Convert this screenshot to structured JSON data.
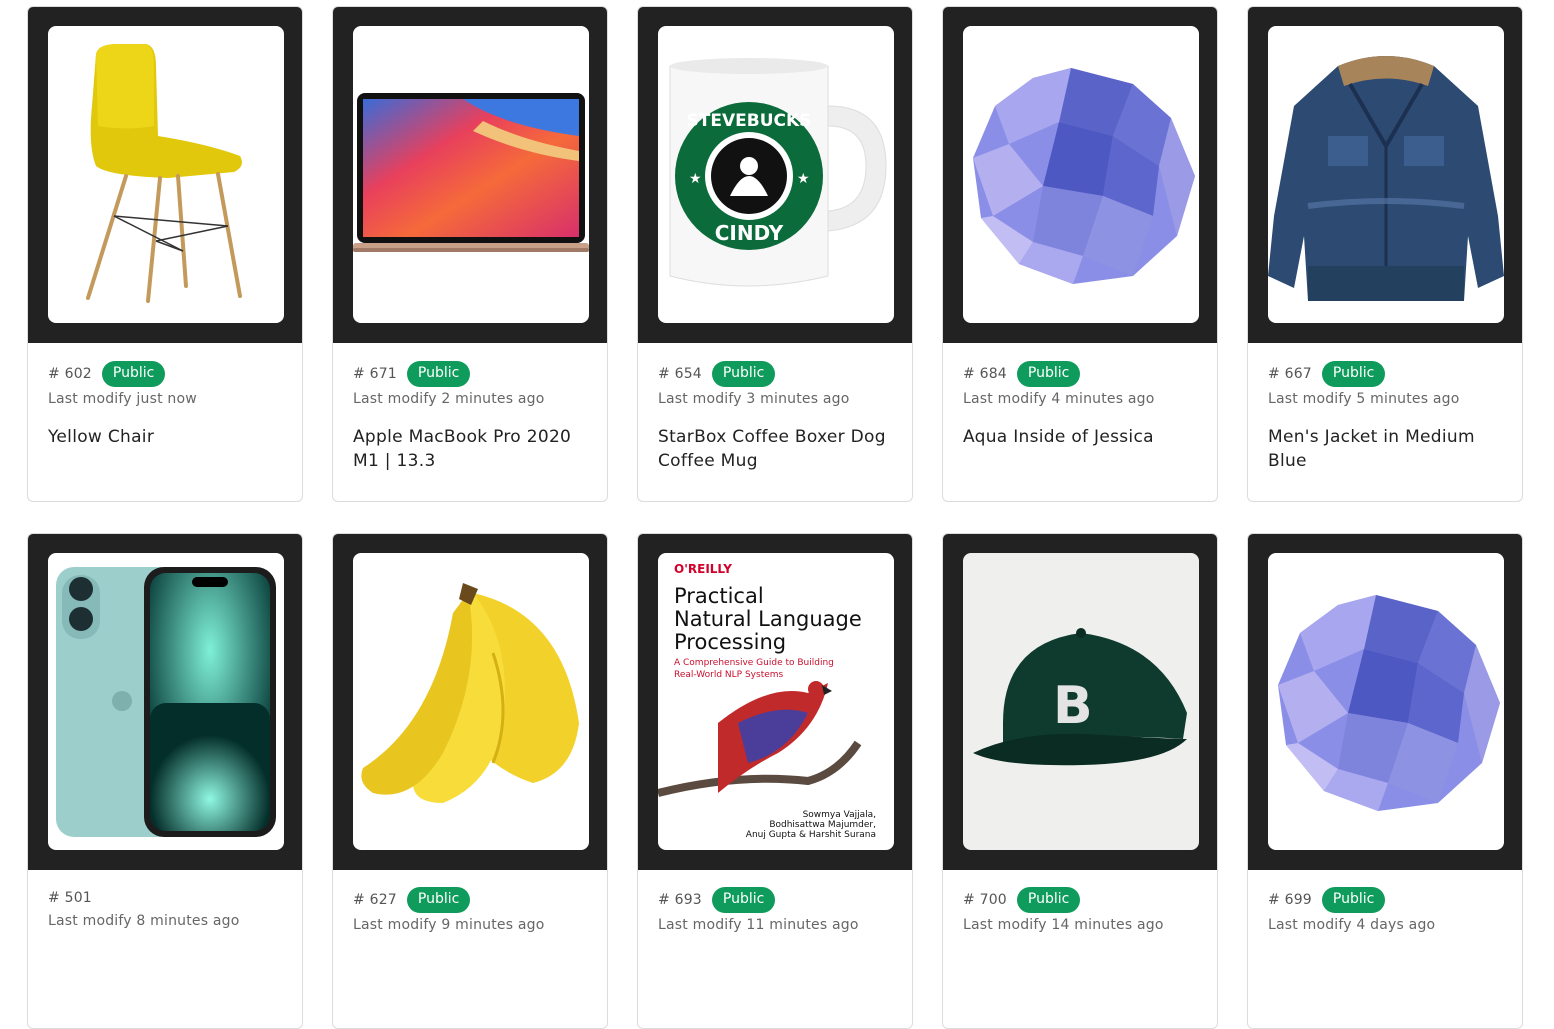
{
  "items": [
    {
      "id": "# 602",
      "badge": "Public",
      "modified": "Last modify just now",
      "title": "Yellow Chair",
      "image": "yellow-chair-image"
    },
    {
      "id": "# 671",
      "badge": "Public",
      "modified": "Last modify 2 minutes ago",
      "title": "Apple MacBook Pro 2020 M1 | 13.3",
      "image": "macbook-image"
    },
    {
      "id": "# 654",
      "badge": "Public",
      "modified": "Last modify 3 minutes ago",
      "title": "StarBox Coffee Boxer Dog Coffee Mug",
      "image": "coffee-mug-image",
      "mug_text_top": "STEVEBUCKS",
      "mug_text_bottom": "CINDY"
    },
    {
      "id": "# 684",
      "badge": "Public",
      "modified": "Last modify 4 minutes ago",
      "title": "Aqua Inside of Jessica",
      "image": "polyhedron-sphere-image"
    },
    {
      "id": "# 667",
      "badge": "Public",
      "modified": "Last modify 5 minutes ago",
      "title": "Men's Jacket in Medium Blue",
      "image": "denim-jacket-image"
    },
    {
      "id": "# 501",
      "badge": "",
      "modified": "Last modify 8 minutes ago",
      "title": "",
      "image": "phone-image"
    },
    {
      "id": "# 627",
      "badge": "Public",
      "modified": "Last modify 9 minutes ago",
      "title": "",
      "image": "bananas-image"
    },
    {
      "id": "# 693",
      "badge": "Public",
      "modified": "Last modify 11 minutes ago",
      "title": "",
      "image": "book-cover-image",
      "book": {
        "publisher": "O'REILLY",
        "title_1": "Practical",
        "title_2": "Natural Language",
        "title_3": "Processing",
        "subtitle_1": "A Comprehensive Guide to Building",
        "subtitle_2": "Real-World NLP Systems",
        "authors_1": "Sowmya Vajjala,",
        "authors_2": "Bodhisattwa Majumder,",
        "authors_3": "Anuj Gupta & Harshit Surana"
      }
    },
    {
      "id": "# 700",
      "badge": "Public",
      "modified": "Last modify 14 minutes ago",
      "title": "",
      "image": "baseball-cap-image",
      "cap_letter": "B"
    },
    {
      "id": "# 699",
      "badge": "Public",
      "modified": "Last modify 4 days ago",
      "title": "",
      "image": "polyhedron-sphere-image"
    }
  ],
  "colors": {
    "frame": "#222222",
    "badge": "#0f9b5c"
  }
}
